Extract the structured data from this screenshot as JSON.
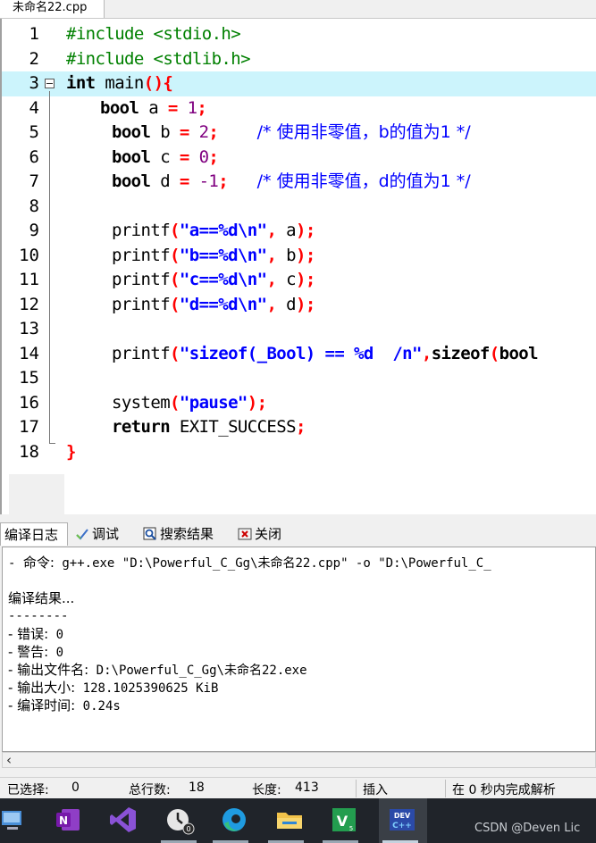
{
  "file_tab": {
    "label": "未命名22.cpp"
  },
  "editor": {
    "line_numbers": [
      "1",
      "2",
      "3",
      "4",
      "5",
      "6",
      "7",
      "8",
      "9",
      "10",
      "11",
      "12",
      "13",
      "14",
      "15",
      "16",
      "17",
      "18"
    ]
  },
  "code": {
    "l1": "#include <stdio.h>",
    "l2": "#include <stdlib.h>",
    "l3": {
      "kw": "int",
      "name": " main",
      "p": "(){"
    },
    "l4": {
      "kw": "bool",
      "id": " a ",
      "eq": "=",
      "sp": " ",
      "num": "1",
      "semi": ";"
    },
    "l5": {
      "kw": "bool",
      "id": " b ",
      "eq": "=",
      "sp": " ",
      "num": "2",
      "semi": ";",
      "gap": "    ",
      "comment": "/* 使用非零值，b的值为1 */"
    },
    "l6": {
      "kw": "bool",
      "id": " c ",
      "eq": "=",
      "sp": " ",
      "num": "0",
      "semi": ";"
    },
    "l7": {
      "kw": "bool",
      "id": " d ",
      "eq": "=",
      "sp": " ",
      "num": "-1",
      "semi": ";",
      "gap": "   ",
      "comment": "/* 使用非零值，d的值为1 */"
    },
    "l9": {
      "fn": "printf",
      "op": "(",
      "str": "\"a==%d\\n\"",
      "comma": ",",
      "arg": " a",
      "close": ");"
    },
    "l10": {
      "fn": "printf",
      "op": "(",
      "str": "\"b==%d\\n\"",
      "comma": ",",
      "arg": " b",
      "close": ");"
    },
    "l11": {
      "fn": "printf",
      "op": "(",
      "str": "\"c==%d\\n\"",
      "comma": ",",
      "arg": " c",
      "close": ");"
    },
    "l12": {
      "fn": "printf",
      "op": "(",
      "str": "\"d==%d\\n\"",
      "comma": ",",
      "arg": " d",
      "close": ");"
    },
    "l14": {
      "fn": "printf",
      "op": "(",
      "str": "\"sizeof(_Bool) == %d  /n\"",
      "comma": ",",
      "kw": "sizeof",
      "op2": "(",
      "kw2": "bool"
    },
    "l16": {
      "fn": "system",
      "op": "(",
      "str": "\"pause\"",
      "close": ");"
    },
    "l17": {
      "kw": "return",
      "id": " EXIT_SUCCESS",
      "semi": ";"
    },
    "l18": {
      "brace": "}"
    }
  },
  "panel_tabs": [
    {
      "label": "编译日志"
    },
    {
      "label": "调试"
    },
    {
      "label": "搜索结果"
    },
    {
      "label": "关闭"
    }
  ],
  "log": {
    "line1_prefix": "- ",
    "line1_cmd_label": "命令:",
    "line1_cmd": " g++.exe \"D:\\Powerful_C_Gg\\未命名22.cpp\" -o \"D:\\Powerful_C_",
    "line3": "编译结果...",
    "line4": "--------",
    "line5_label": "- 错误:",
    "line5_val": " 0",
    "line6_label": "- 警告:",
    "line6_val": " 0",
    "line7_label": "- 输出文件名:",
    "line7_val": " D:\\Powerful_C_Gg\\未命名22.exe",
    "line8_label": "- 输出大小:",
    "line8_val": " 128.1025390625 KiB",
    "line9_label": "- 编译时间:",
    "line9_val": " 0.24s"
  },
  "status": {
    "selected_label": "已选择:",
    "selected_value": "0",
    "total_lines_label": "总行数:",
    "total_lines_value": "18",
    "length_label": "长度:",
    "length_value": "413",
    "mode": "插入",
    "parse": "在 0 秒内完成解析"
  },
  "taskbar": {
    "icons": [
      "network-icon",
      "onenote-icon",
      "visual-studio-icon",
      "clock-app-icon",
      "edge-icon",
      "file-explorer-icon",
      "vim-icon",
      "devcpp-icon"
    ],
    "watermark": "CSDN @Deven Lic"
  }
}
